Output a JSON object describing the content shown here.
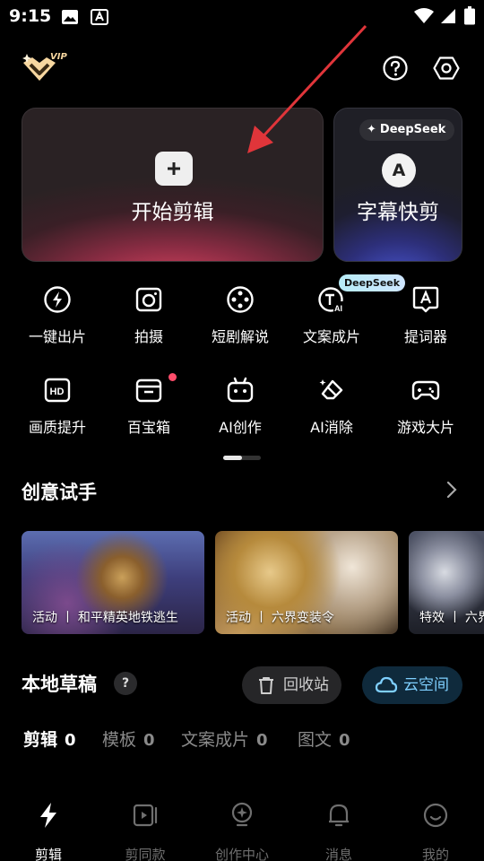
{
  "status_bar": {
    "time": "9:15"
  },
  "main_actions": {
    "start_edit_label": "开始剪辑",
    "subtitle_edit_label": "字幕快剪",
    "deepseek_badge": "DeepSeek",
    "subtitle_icon_letter": "A"
  },
  "logo": {
    "vip_text": "VIP"
  },
  "tools": [
    {
      "label": "一键出片",
      "icon": "lightning-circle-icon"
    },
    {
      "label": "拍摄",
      "icon": "camera-icon"
    },
    {
      "label": "短剧解说",
      "icon": "film-reel-icon"
    },
    {
      "label": "文案成片",
      "icon": "text-ai-icon",
      "badge": "DeepSeek"
    },
    {
      "label": "提词器",
      "icon": "teleprompter-icon"
    },
    {
      "label": "画质提升",
      "icon": "hd-icon"
    },
    {
      "label": "百宝箱",
      "icon": "toolbox-icon"
    },
    {
      "label": "AI创作",
      "icon": "robot-icon"
    },
    {
      "label": "AI消除",
      "icon": "eraser-icon"
    },
    {
      "label": "游戏大片",
      "icon": "gamepad-icon"
    }
  ],
  "creative": {
    "title": "创意试手",
    "items": [
      {
        "caption": "活动 丨 和平精英地铁逃生"
      },
      {
        "caption": "活动 丨 六界变装令"
      },
      {
        "caption": "特效 丨 六界"
      }
    ]
  },
  "drafts": {
    "title": "本地草稿",
    "help": "?",
    "recycle_label": "回收站",
    "cloud_label": "云空间",
    "tabs": [
      {
        "label": "剪辑",
        "count": "0"
      },
      {
        "label": "模板",
        "count": "0"
      },
      {
        "label": "文案成片",
        "count": "0"
      },
      {
        "label": "图文",
        "count": "0"
      }
    ]
  },
  "bottom_nav": [
    {
      "label": "剪辑",
      "icon": "bolt-icon"
    },
    {
      "label": "剪同款",
      "icon": "video-template-icon"
    },
    {
      "label": "创作中心",
      "icon": "lightbulb-icon"
    },
    {
      "label": "消息",
      "icon": "bell-icon"
    },
    {
      "label": "我的",
      "icon": "smiley-icon"
    }
  ],
  "colors": {
    "background": "#000000",
    "accent_cloud": "#7fd0ff",
    "badge_red": "#ff4d6b",
    "arrow_red": "#e0353a"
  }
}
